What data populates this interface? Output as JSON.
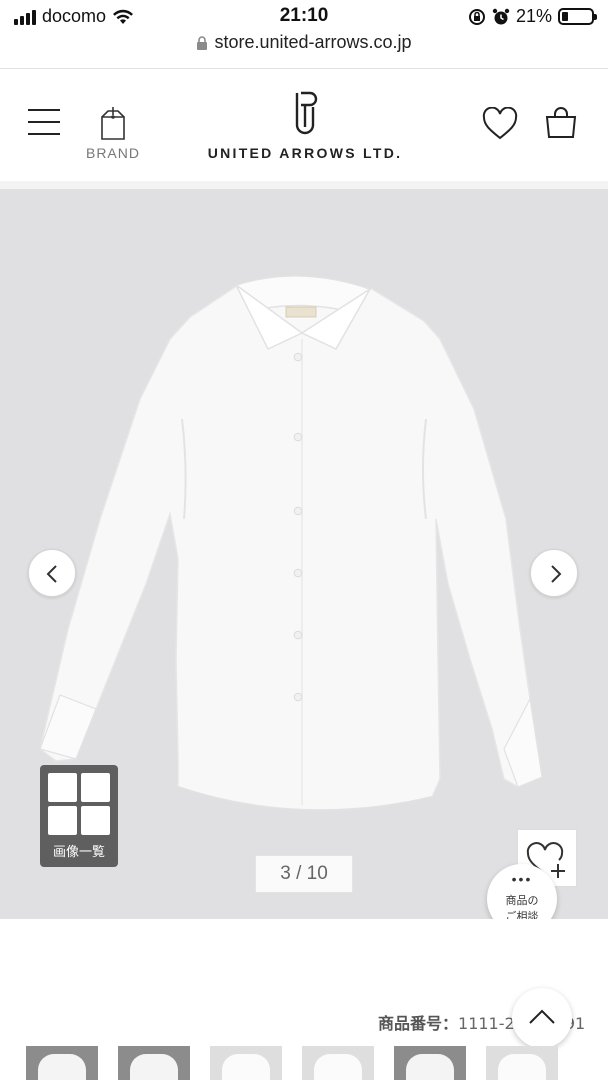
{
  "status_bar": {
    "carrier": "docomo",
    "time": "21:10",
    "battery_text": "21%",
    "battery_level": 0.21,
    "icons": [
      "signal-icon",
      "wifi-icon",
      "orientation-lock-icon",
      "alarm-icon",
      "battery-icon"
    ]
  },
  "browser": {
    "url": "store.united-arrows.co.jp"
  },
  "header": {
    "brand_label": "BRAND",
    "logo_text": "UNITED ARROWS LTD.",
    "icons": [
      "menu-icon",
      "brand-tag-icon",
      "logo-mark-icon",
      "heart-icon",
      "shopping-bag-icon"
    ]
  },
  "gallery": {
    "image_list_label": "画像一覧",
    "counter": "3 / 10",
    "current_index": 3,
    "total_images": 10,
    "background_color": "#e0e0e2"
  },
  "consult": {
    "dots": "•••",
    "line1": "商品の",
    "line2": "ご相談"
  },
  "product": {
    "number_label": "商品番号：",
    "number_value": "1111-25",
    "number_suffix": "91"
  },
  "thumbnails": [
    {
      "style": "dark"
    },
    {
      "style": "dark"
    },
    {
      "style": "light"
    },
    {
      "style": "light"
    },
    {
      "style": "dark"
    },
    {
      "style": "light"
    }
  ]
}
